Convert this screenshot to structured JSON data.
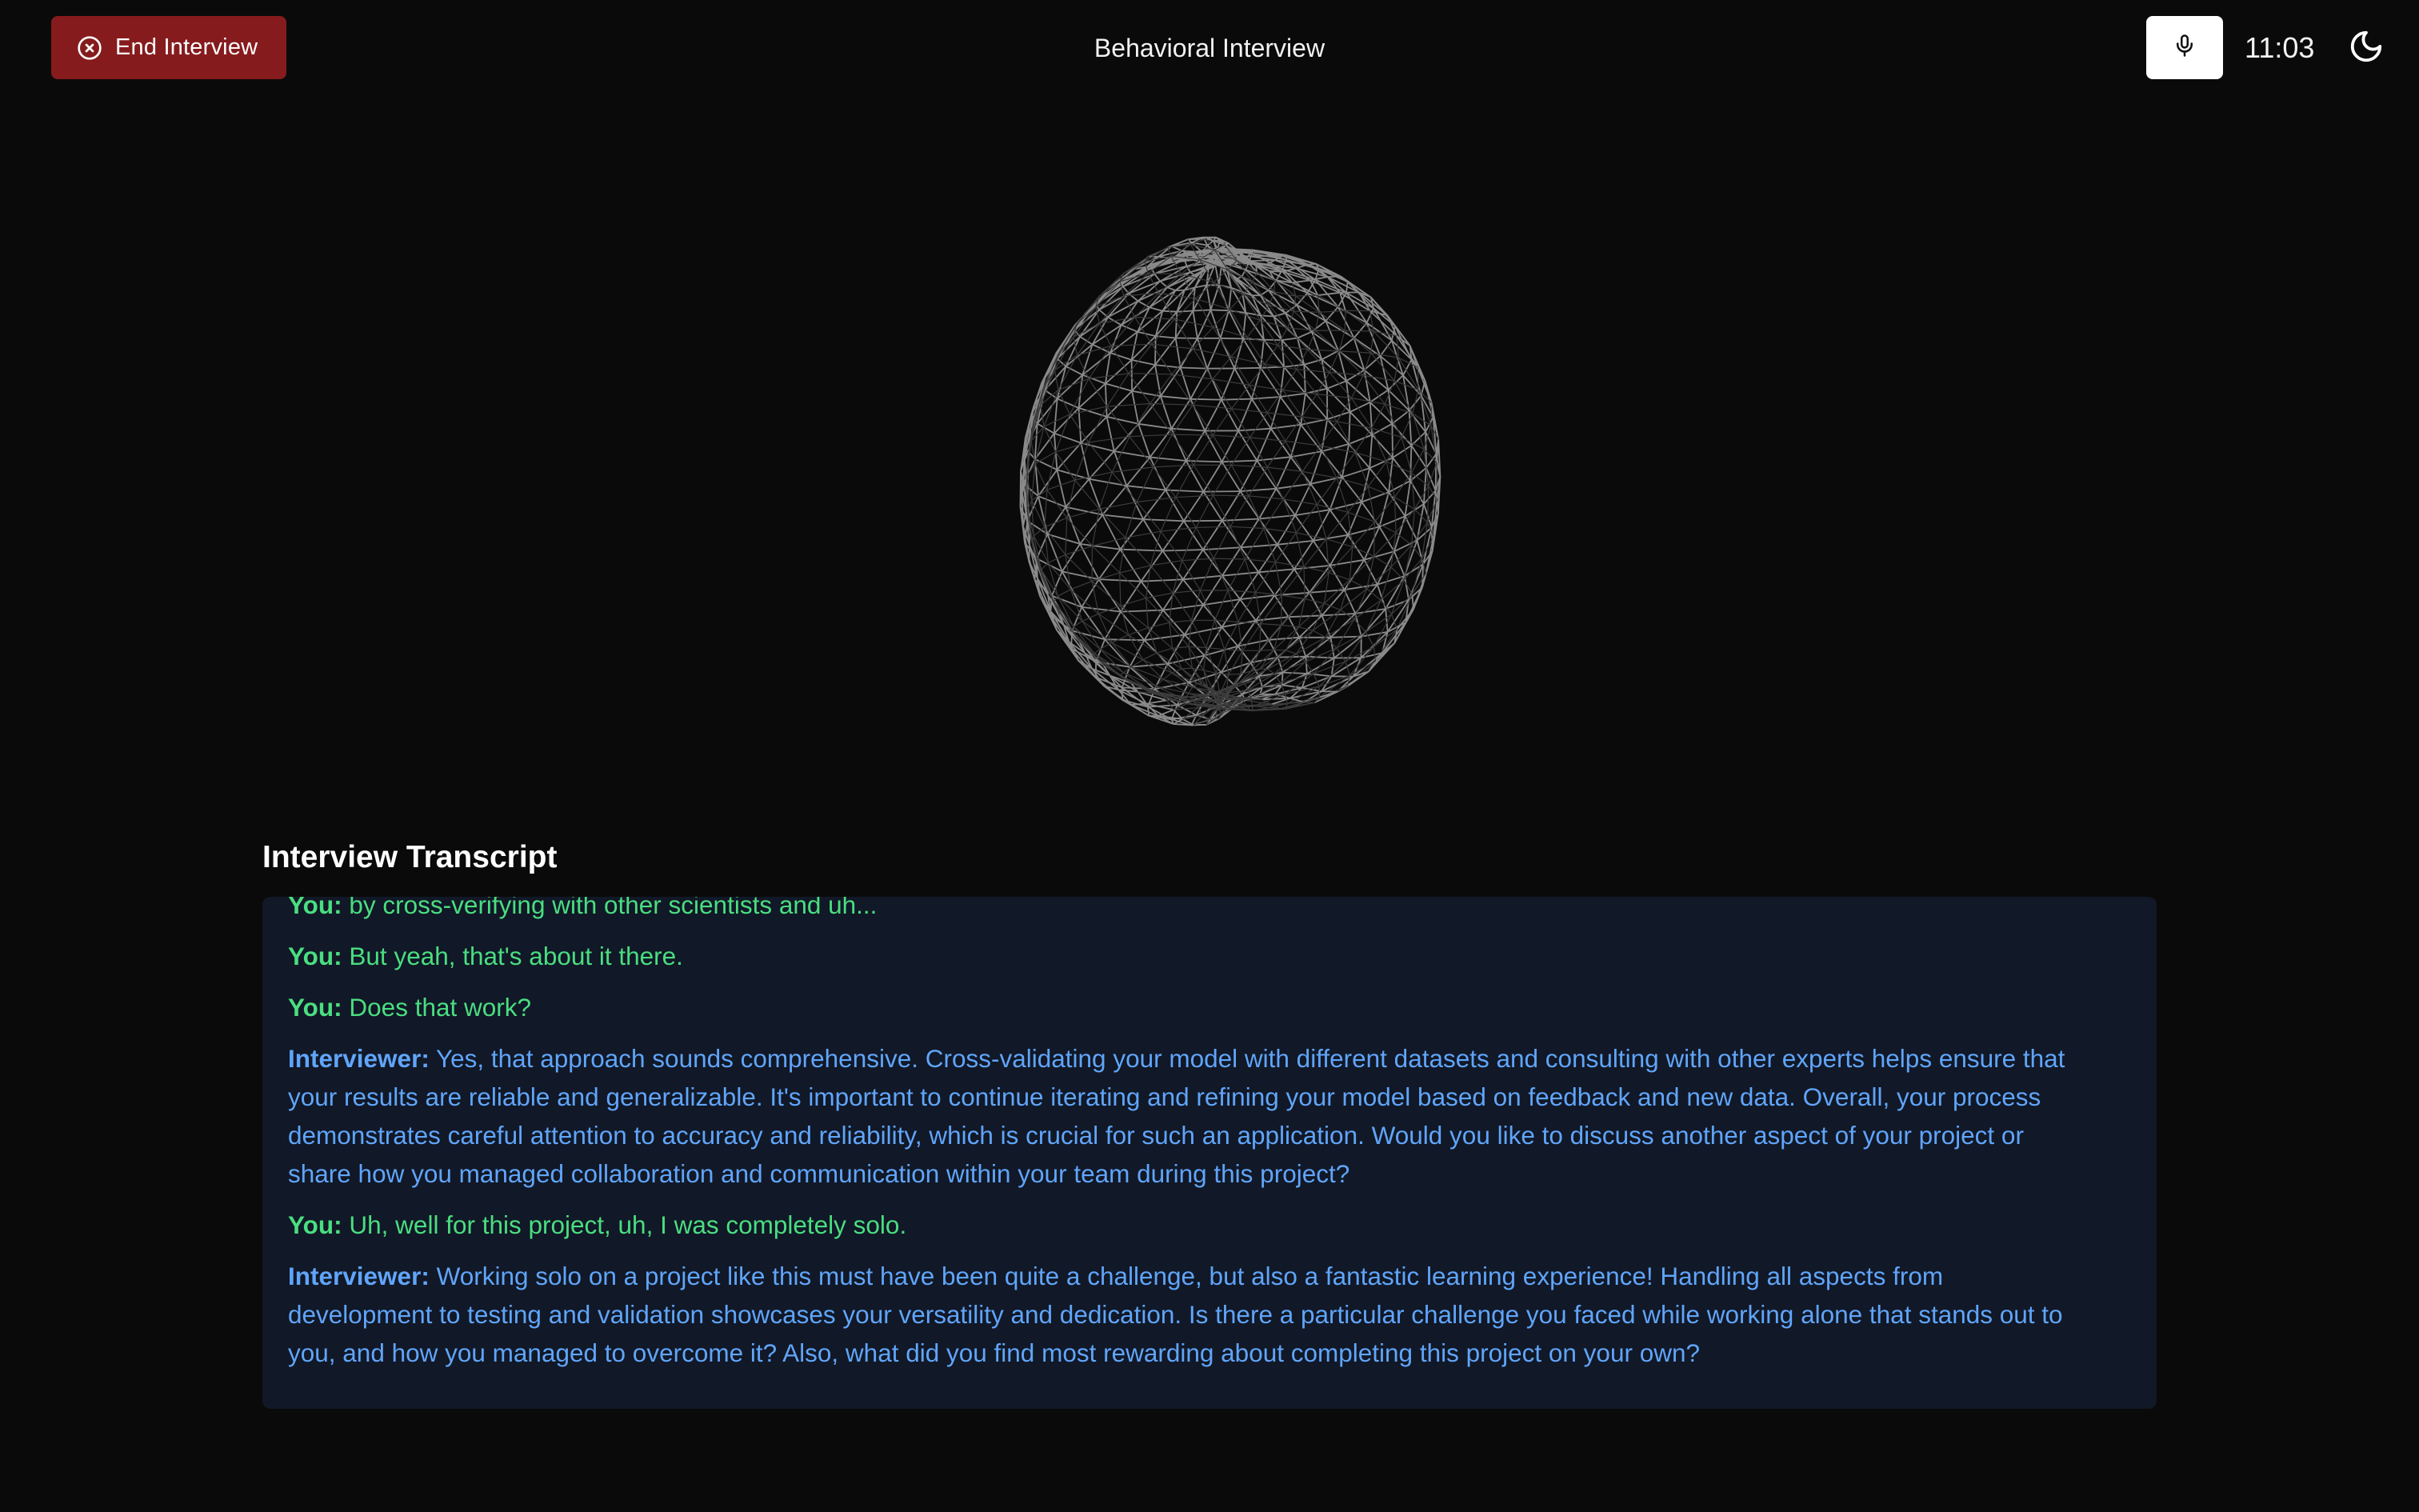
{
  "header": {
    "end_button_label": "End Interview",
    "title": "Behavioral Interview",
    "timer": "11:03"
  },
  "icons": {
    "end": "x-circle-icon",
    "mic": "microphone-icon",
    "theme": "moon-icon"
  },
  "colors": {
    "end_button": "#861b1d",
    "you_text": "#4ade80",
    "interviewer_text": "#60a5fa",
    "transcript_bg": "#111827"
  },
  "transcript": {
    "heading": "Interview Transcript",
    "messages": [
      {
        "speaker": "You:",
        "role": "you",
        "text": " by cross-verifying with other scientists and uh..."
      },
      {
        "speaker": "You:",
        "role": "you",
        "text": " But yeah, that's about it there."
      },
      {
        "speaker": "You:",
        "role": "you",
        "text": " Does that work?"
      },
      {
        "speaker": "Interviewer:",
        "role": "interviewer",
        "text": " Yes, that approach sounds comprehensive. Cross-validating your model with different datasets and consulting with other experts helps ensure that your results are reliable and generalizable. It's important to continue iterating and refining your model based on feedback and new data. Overall, your process demonstrates careful attention to accuracy and reliability, which is crucial for such an application. Would you like to discuss another aspect of your project or share how you managed collaboration and communication within your team during this project?"
      },
      {
        "speaker": "You:",
        "role": "you",
        "text": " Uh, well for this project, uh, I was completely solo."
      },
      {
        "speaker": "Interviewer:",
        "role": "interviewer",
        "text": " Working solo on a project like this must have been quite a challenge, but also a fantastic learning experience! Handling all aspects from development to testing and validation showcases your versatility and dedication. Is there a particular challenge you faced while working alone that stands out to you, and how you managed to overcome it? Also, what did you find most rewarding about completing this project on your own?"
      }
    ]
  }
}
